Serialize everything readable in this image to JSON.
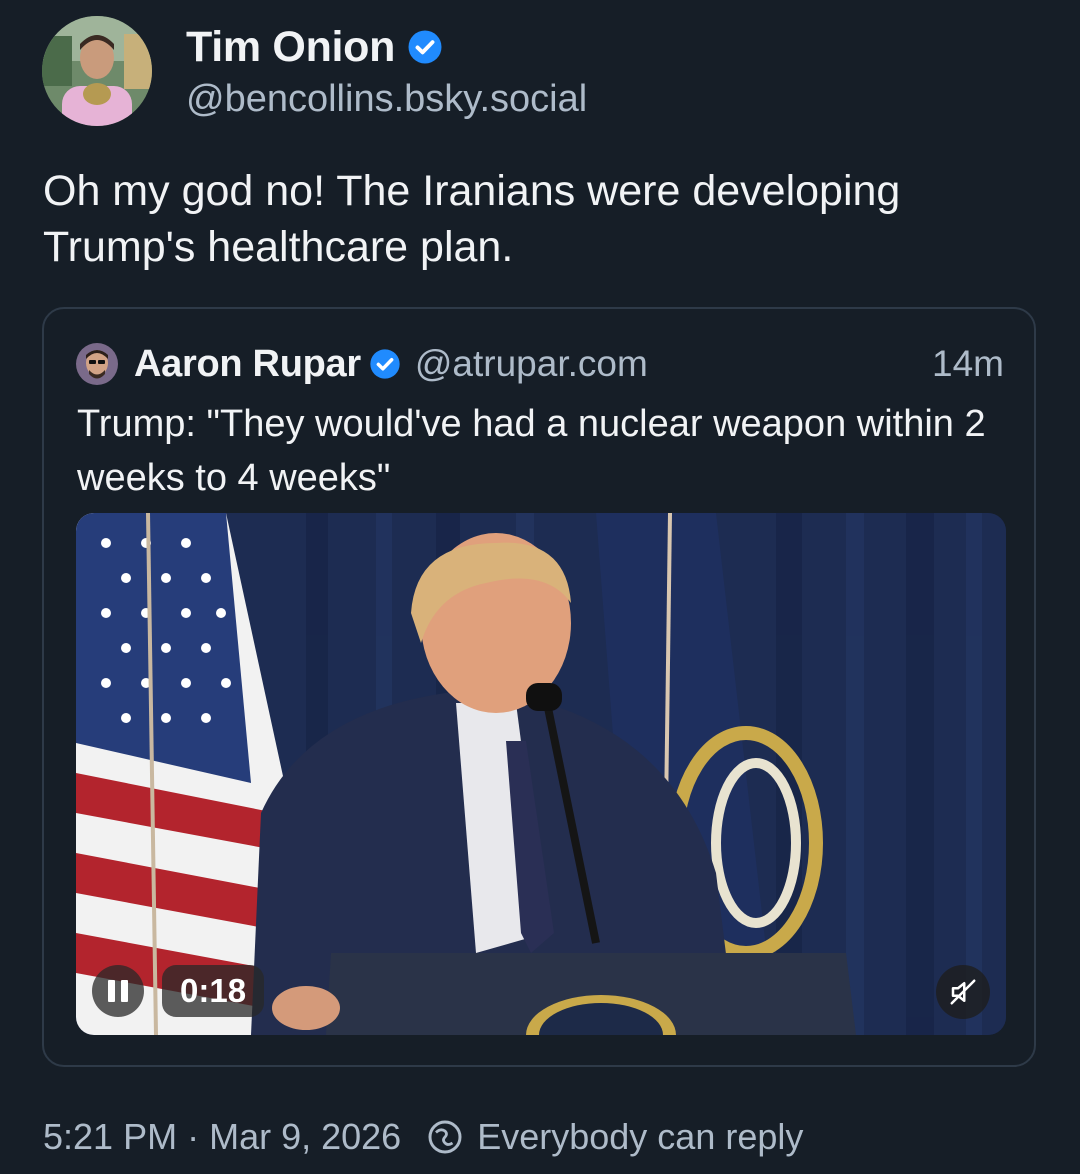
{
  "post": {
    "author_name": "Tim Onion",
    "author_handle": "@bencollins.bsky.social",
    "text": "Oh my god no! The Iranians were developing Trump's healthcare plan.",
    "timestamp": "5:21 PM",
    "separator": "·",
    "date": "Mar 9, 2026",
    "reply_setting": "Everybody can reply"
  },
  "quote": {
    "author_name": "Aaron Rupar",
    "author_handle": "@atrupar.com",
    "time_ago": "14m",
    "text": "Trump: \"They would've had a nuclear weapon within 2 weeks to 4 weeks\"",
    "video": {
      "duration": "0:18",
      "playing": true,
      "muted": true
    }
  },
  "icons": {
    "verified": "verified-check-icon",
    "pause": "pause-icon",
    "mute": "muted-speaker-icon",
    "reply_setting": "globe-reply-icon"
  },
  "colors": {
    "background": "#161e27",
    "verified": "#208bfe",
    "secondary_text": "#aebbc9",
    "border": "#2e3a48"
  }
}
